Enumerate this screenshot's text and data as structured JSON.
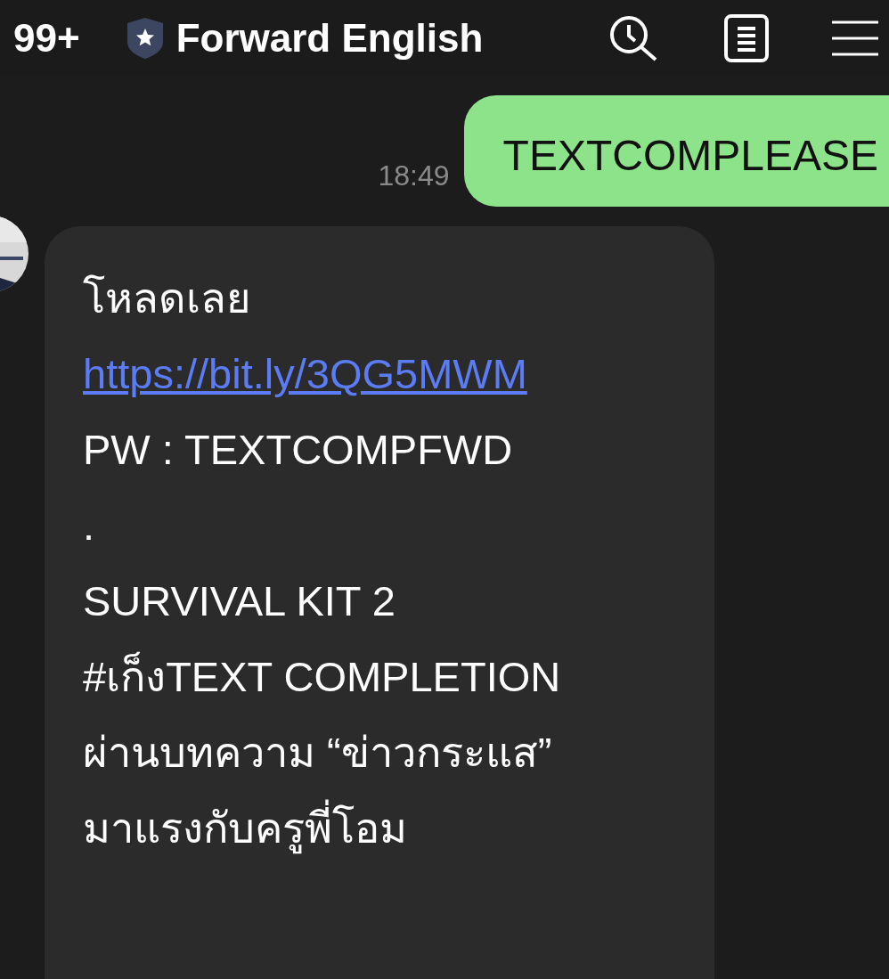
{
  "header": {
    "unread_count": "99+",
    "title": "Forward English"
  },
  "messages": [
    {
      "kind": "outgoing",
      "time": "18:49",
      "text": "TEXTCOMPLEASE"
    },
    {
      "kind": "incoming",
      "lines": [
        {
          "kind": "text",
          "text": "โหลดเลย"
        },
        {
          "kind": "link",
          "text": "https://bit.ly/3QG5MWM"
        },
        {
          "kind": "text",
          "text": "PW : TEXTCOMPFWD"
        },
        {
          "kind": "text",
          "text": "."
        },
        {
          "kind": "text",
          "text": "SURVIVAL KIT 2"
        },
        {
          "kind": "text",
          "text": "#เก็งTEXT COMPLETION"
        },
        {
          "kind": "text",
          "text": "ผ่านบทความ “ข่าวกระแส”"
        },
        {
          "kind": "text",
          "text": "มาแรงกับครูพี่โอม"
        }
      ]
    }
  ]
}
